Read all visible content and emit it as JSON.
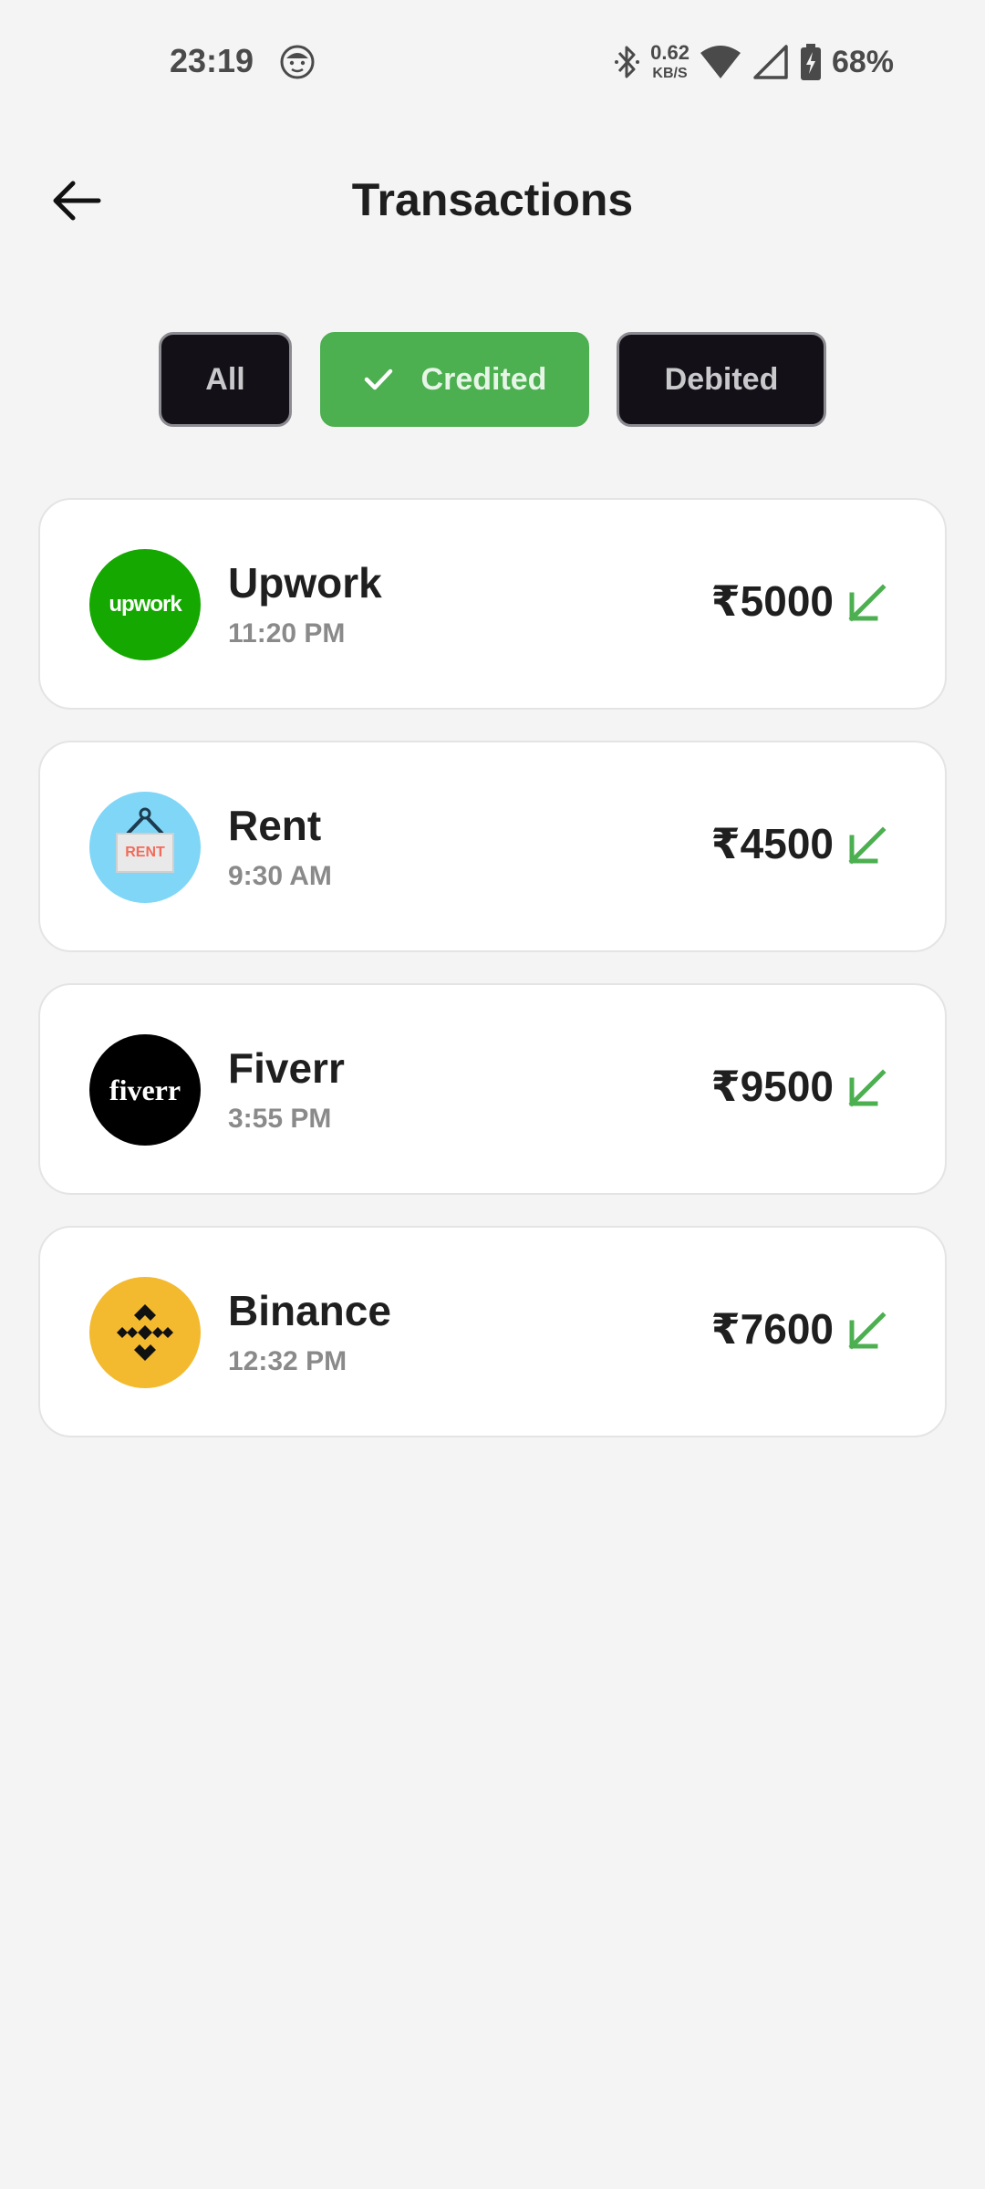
{
  "status_bar": {
    "time": "23:19",
    "net_speed_value": "0.62",
    "net_speed_unit": "KB/S",
    "battery": "68%"
  },
  "header": {
    "title": "Transactions",
    "back_icon": "arrow-left-icon"
  },
  "filters": {
    "all": "All",
    "credited": "Credited",
    "debited": "Debited",
    "selected": "Credited",
    "colors": {
      "active": "#4caf50",
      "inactive": "#131117"
    }
  },
  "transactions": [
    {
      "name": "Upwork",
      "time": "11:20 PM",
      "amount": "₹5000",
      "logo_text": "upwork",
      "logo_color": "#14a800",
      "direction_icon": "arrow-down-left-icon"
    },
    {
      "name": "Rent",
      "time": "9:30 AM",
      "amount": "₹4500",
      "logo_text": "RENT",
      "logo_color": "#7fd6f7",
      "direction_icon": "arrow-down-left-icon"
    },
    {
      "name": "Fiverr",
      "time": "3:55 PM",
      "amount": "₹9500",
      "logo_text": "fiverr",
      "logo_color": "#000000",
      "direction_icon": "arrow-down-left-icon"
    },
    {
      "name": "Binance",
      "time": "12:32 PM",
      "amount": "₹7600",
      "logo_text": "",
      "logo_color": "#f3ba2f",
      "direction_icon": "arrow-down-left-icon"
    }
  ],
  "accent_colors": {
    "credit_arrow": "#4caf50"
  }
}
